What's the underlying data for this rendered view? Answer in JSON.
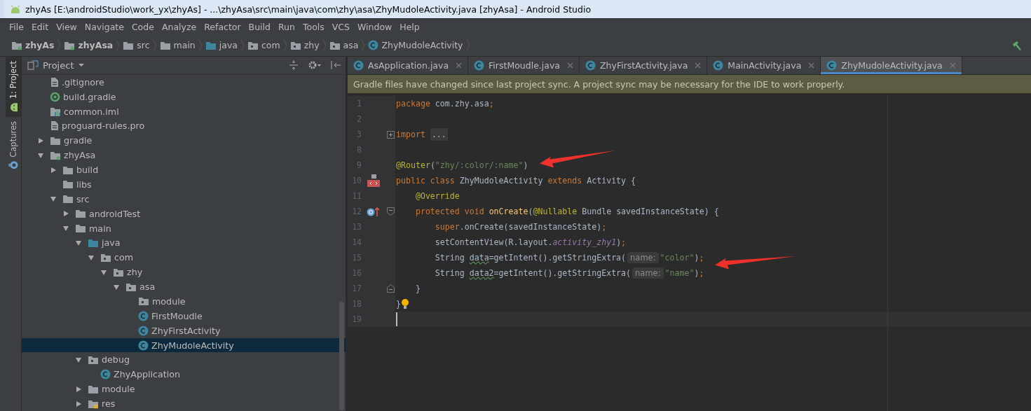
{
  "window": {
    "title": "zhyAs [E:\\androidStudio\\work_yx\\zhyAs] - ...\\zhyAsa\\src\\main\\java\\com\\zhy\\asa\\ZhyMudoleActivity.java [zhyAsa] - Android Studio"
  },
  "menu": [
    "File",
    "Edit",
    "View",
    "Navigate",
    "Code",
    "Analyze",
    "Refactor",
    "Build",
    "Run",
    "Tools",
    "VCS",
    "Window",
    "Help"
  ],
  "breadcrumb": [
    {
      "label": "zhyAs",
      "kind": "project"
    },
    {
      "label": "zhyAsa",
      "kind": "module"
    },
    {
      "label": "src",
      "kind": "folder"
    },
    {
      "label": "main",
      "kind": "folder"
    },
    {
      "label": "java",
      "kind": "source"
    },
    {
      "label": "com",
      "kind": "package"
    },
    {
      "label": "zhy",
      "kind": "package"
    },
    {
      "label": "asa",
      "kind": "package"
    },
    {
      "label": "ZhyMudoleActivity",
      "kind": "class"
    }
  ],
  "tool_stripe": [
    {
      "label": "1: Project",
      "kind": "android",
      "selected": true
    },
    {
      "label": "Captures",
      "kind": "captures",
      "selected": false
    }
  ],
  "project_panel": {
    "title": "Project",
    "tree": [
      {
        "label": ".gitignore",
        "kind": "file"
      },
      {
        "label": "build.gradle",
        "kind": "gradle"
      },
      {
        "label": "common.iml",
        "kind": "iml"
      },
      {
        "label": "proguard-rules.pro",
        "kind": "file"
      },
      {
        "label": "gradle",
        "kind": "folder",
        "expanded": false
      },
      {
        "label": "zhyAsa",
        "kind": "module",
        "expanded": true,
        "children": [
          {
            "label": "build",
            "kind": "folder",
            "expanded": false
          },
          {
            "label": "libs",
            "kind": "folder"
          },
          {
            "label": "src",
            "kind": "folder",
            "expanded": true,
            "children": [
              {
                "label": "androidTest",
                "kind": "folder",
                "expanded": false
              },
              {
                "label": "main",
                "kind": "folder",
                "expanded": true,
                "children": [
                  {
                    "label": "java",
                    "kind": "source",
                    "expanded": true,
                    "children": [
                      {
                        "label": "com",
                        "kind": "package",
                        "expanded": true,
                        "children": [
                          {
                            "label": "zhy",
                            "kind": "package",
                            "expanded": true,
                            "children": [
                              {
                                "label": "asa",
                                "kind": "package",
                                "expanded": true,
                                "children": [
                                  {
                                    "label": "module",
                                    "kind": "package"
                                  },
                                  {
                                    "label": "FirstMoudle",
                                    "kind": "class",
                                    "selected": false
                                  },
                                  {
                                    "label": "ZhyFirstActivity",
                                    "kind": "class",
                                    "selected": false
                                  },
                                  {
                                    "label": "ZhyMudoleActivity",
                                    "kind": "class",
                                    "selected": true
                                  }
                                ]
                              }
                            ]
                          }
                        ]
                      }
                    ]
                  },
                  {
                    "label": "debug",
                    "kind": "package",
                    "expanded": true,
                    "children": [
                      {
                        "label": "ZhyApplication",
                        "kind": "class",
                        "selected": false
                      }
                    ]
                  },
                  {
                    "label": "module",
                    "kind": "folder",
                    "expanded": false
                  },
                  {
                    "label": "res",
                    "kind": "res",
                    "expanded": false
                  }
                ]
              }
            ]
          }
        ]
      }
    ]
  },
  "tabs": [
    {
      "label": "AsApplication.java",
      "selected": false
    },
    {
      "label": "FirstMoudle.java",
      "selected": false
    },
    {
      "label": "ZhyFirstActivity.java",
      "selected": false
    },
    {
      "label": "MainActivity.java",
      "selected": false
    },
    {
      "label": "ZhyMudoleActivity.java",
      "selected": true
    }
  ],
  "notification": "Gradle files have changed since last project sync. A project sync may be necessary for the IDE to work properly.",
  "code": [
    {
      "number": "1",
      "tokens": [
        {
          "kind": "keyword",
          "text": "package "
        },
        {
          "kind": "plain",
          "text": "com.zhy.asa"
        },
        {
          "kind": "keyword",
          "text": ";"
        }
      ]
    },
    {
      "number": "2"
    },
    {
      "number": "3",
      "fold": {
        "kind": "plus"
      },
      "tokens": [
        {
          "kind": "keyword",
          "text": "import "
        },
        {
          "kind": "folded",
          "text": "..."
        }
      ]
    },
    {
      "number": "8"
    },
    {
      "number": "9",
      "tokens": [
        {
          "kind": "annotation",
          "text": "@Router"
        },
        {
          "kind": "plain",
          "text": "("
        },
        {
          "kind": "string",
          "text": "\"zhy/:color/:name\""
        },
        {
          "kind": "plain",
          "text": ")"
        }
      ]
    },
    {
      "number": "10",
      "gutter": {
        "kind": "layout"
      },
      "tokens": [
        {
          "kind": "keyword",
          "text": "public class "
        },
        {
          "kind": "plain",
          "text": "ZhyMudoleActivity "
        },
        {
          "kind": "keyword",
          "text": "extends "
        },
        {
          "kind": "plain",
          "text": "Activity {"
        }
      ]
    },
    {
      "number": "11",
      "tokens": [
        {
          "kind": "annotation",
          "text": "    @Override"
        }
      ]
    },
    {
      "number": "12",
      "gutter": {
        "kind": "override"
      },
      "fold": {
        "kind": "open"
      },
      "tokens": [
        {
          "kind": "keyword",
          "text": "    protected void "
        },
        {
          "kind": "method",
          "text": "onCreate"
        },
        {
          "kind": "plain",
          "text": "("
        },
        {
          "kind": "annotation",
          "text": "@Nullable "
        },
        {
          "kind": "plain",
          "text": "Bundle savedInstanceState) {"
        }
      ]
    },
    {
      "number": "13",
      "tokens": [
        {
          "kind": "keyword",
          "text": "        super"
        },
        {
          "kind": "plain",
          "text": ".onCreate(savedInstanceState)"
        },
        {
          "kind": "keyword",
          "text": ";"
        }
      ]
    },
    {
      "number": "14",
      "tokens": [
        {
          "kind": "plain",
          "text": "        setContentView(R.layout."
        },
        {
          "kind": "field",
          "text": "activity_zhy1"
        },
        {
          "kind": "plain",
          "text": ")"
        },
        {
          "kind": "keyword",
          "text": ";"
        }
      ]
    },
    {
      "number": "15",
      "tokens": [
        {
          "kind": "plain",
          "text": "        String "
        },
        {
          "kind": "unused",
          "text": "data"
        },
        {
          "kind": "plain",
          "text": "=getIntent().getStringExtra("
        },
        {
          "kind": "hint",
          "text": "name:"
        },
        {
          "kind": "string",
          "text": "\"color\""
        },
        {
          "kind": "plain",
          "text": ")"
        },
        {
          "kind": "keyword",
          "text": ";"
        }
      ]
    },
    {
      "number": "16",
      "tokens": [
        {
          "kind": "plain",
          "text": "        String "
        },
        {
          "kind": "unused",
          "text": "data2"
        },
        {
          "kind": "plain",
          "text": "=getIntent().getStringExtra("
        },
        {
          "kind": "hint",
          "text": "name:"
        },
        {
          "kind": "string",
          "text": "\"name\""
        },
        {
          "kind": "plain",
          "text": ")"
        },
        {
          "kind": "keyword",
          "text": ";"
        }
      ]
    },
    {
      "number": "17",
      "fold": {
        "kind": "close"
      },
      "tokens": [
        {
          "kind": "plain",
          "text": "    }"
        }
      ]
    },
    {
      "number": "18",
      "bulb": true,
      "tokens": [
        {
          "kind": "plain",
          "text": "}"
        }
      ]
    },
    {
      "number": "19",
      "current": true
    }
  ]
}
